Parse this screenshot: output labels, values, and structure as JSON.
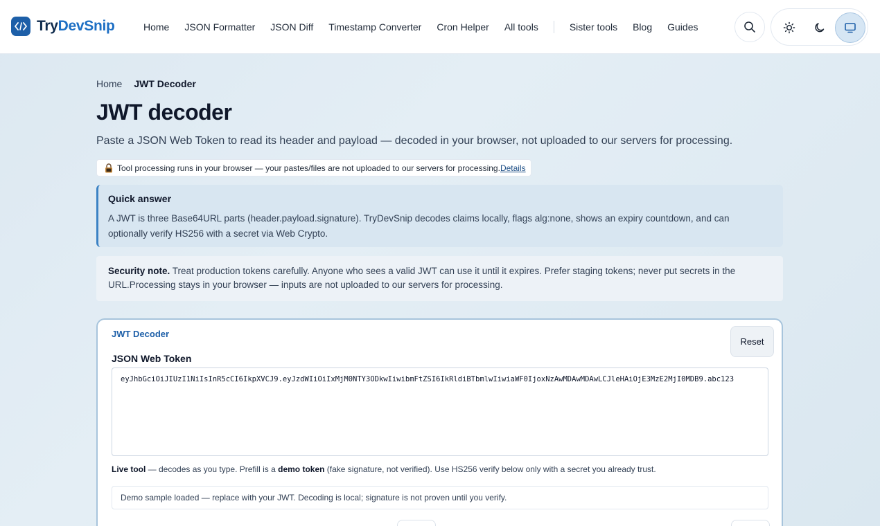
{
  "brand": {
    "name_part1": "Try",
    "name_part2": "DevSnip"
  },
  "nav": {
    "items": [
      "Home",
      "JSON Formatter",
      "JSON Diff",
      "Timestamp Converter",
      "Cron Helper",
      "All tools"
    ],
    "secondary": [
      "Sister tools",
      "Blog",
      "Guides"
    ]
  },
  "header_icons": {
    "search": "search-icon",
    "light": "sun-icon",
    "dark": "moon-icon",
    "system": "monitor-icon"
  },
  "breadcrumb": {
    "home": "Home",
    "current": "JWT Decoder"
  },
  "page": {
    "title": "JWT decoder",
    "subtitle": "Paste a JSON Web Token to read its header and payload — decoded in your browser, not uploaded to our servers for processing."
  },
  "privacy": {
    "text": "Tool processing runs in your browser — your pastes/files are not uploaded to our servers for processing.",
    "link": "Details"
  },
  "quick_answer": {
    "heading": "Quick answer",
    "body": "A JWT is three Base64URL parts (header.payload.signature). TryDevSnip decodes claims locally, flags alg:none, shows an expiry countdown, and can optionally verify HS256 with a secret via Web Crypto."
  },
  "security": {
    "label": "Security note.",
    "body": " Treat production tokens carefully. Anyone who sees a valid JWT can use it until it expires. Prefer staging tokens; never put secrets in the URL.Processing stays in your browser — inputs are not uploaded to our servers for processing."
  },
  "tool": {
    "label": "JWT Decoder",
    "reset": "Reset",
    "field_label": "JSON Web Token",
    "token_value": "eyJhbGciOiJIUzI1NiIsInR5cCI6IkpXVCJ9.eyJzdWIiOiIxMjM0NTY3ODkwIiwibmFtZSI6IkRldiBTbmlwIiwiaWF0IjoxNzAwMDAwMDAwLCJleHAiOjE3MzE2MjI0MDB9.abc123",
    "live_label": "Live tool",
    "live_text_1": " — decodes as you type. Prefill is a ",
    "demo_label": "demo token",
    "live_text_2": " (fake signature, not verified). Use HS256 verify below only with a secret you already trust.",
    "status": "Demo sample loaded — replace with your JWT. Decoding is local; signature is not proven until you verify."
  },
  "colors": {
    "brand": "#1d5fa8",
    "accent_border": "#3b82c4",
    "page_bg": "#dce8f1"
  }
}
